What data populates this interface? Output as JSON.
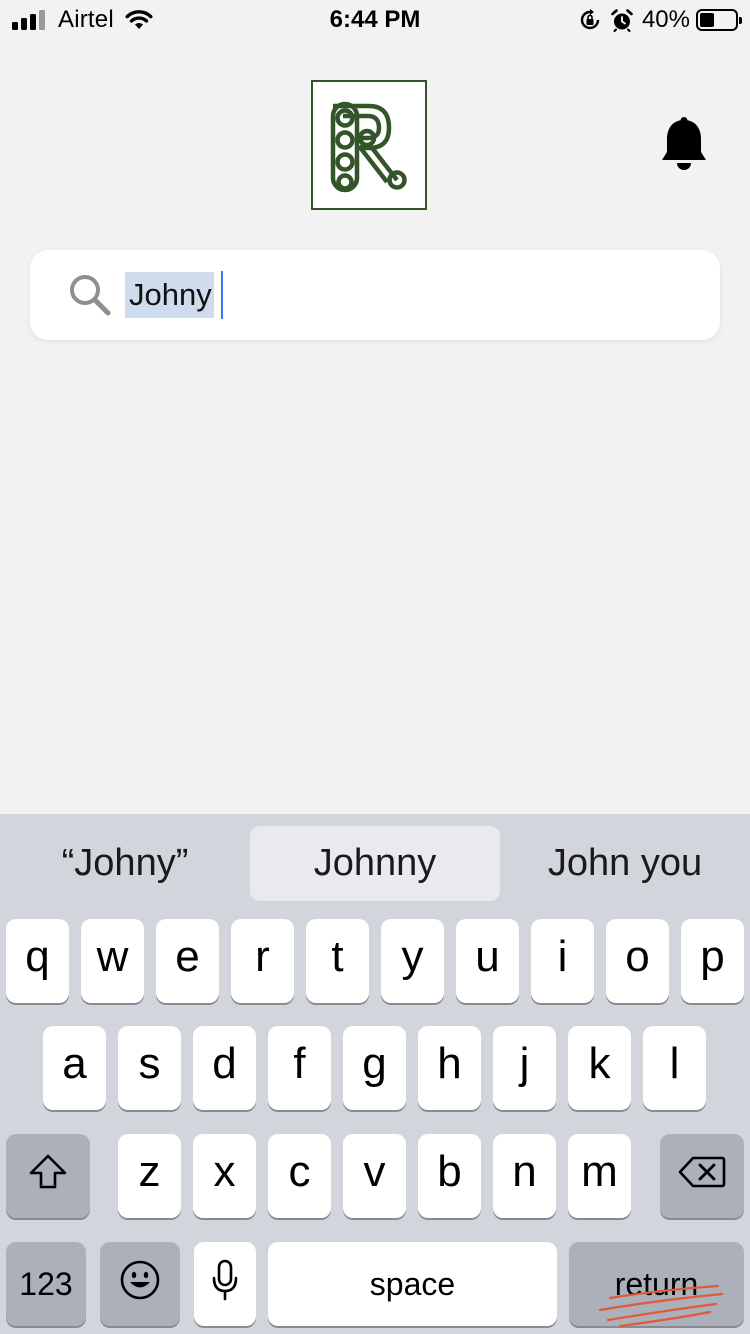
{
  "status_bar": {
    "carrier": "Airtel",
    "time": "6:44 PM",
    "battery_percent": "40%",
    "battery_level": 0.4,
    "icons": [
      "signal-icon",
      "wifi-icon",
      "orientation-lock-icon",
      "alarm-icon",
      "battery-icon"
    ]
  },
  "header": {
    "logo_letter": "R",
    "logo_color": "#34542a",
    "notification_icon": "bell-icon"
  },
  "search": {
    "value": "Johny",
    "value_selected": true,
    "icon": "search-icon"
  },
  "keyboard": {
    "suggestions": [
      "“Johny”",
      "Johnny",
      "John you"
    ],
    "row1": [
      "q",
      "w",
      "e",
      "r",
      "t",
      "y",
      "u",
      "i",
      "o",
      "p"
    ],
    "row2": [
      "a",
      "s",
      "d",
      "f",
      "g",
      "h",
      "j",
      "k",
      "l"
    ],
    "row3": [
      "z",
      "x",
      "c",
      "v",
      "b",
      "n",
      "m"
    ],
    "numbers_label": "123",
    "space_label": "space",
    "return_label": "return",
    "icons": [
      "shift-icon",
      "backspace-icon",
      "emoji-icon",
      "microphone-icon"
    ]
  }
}
